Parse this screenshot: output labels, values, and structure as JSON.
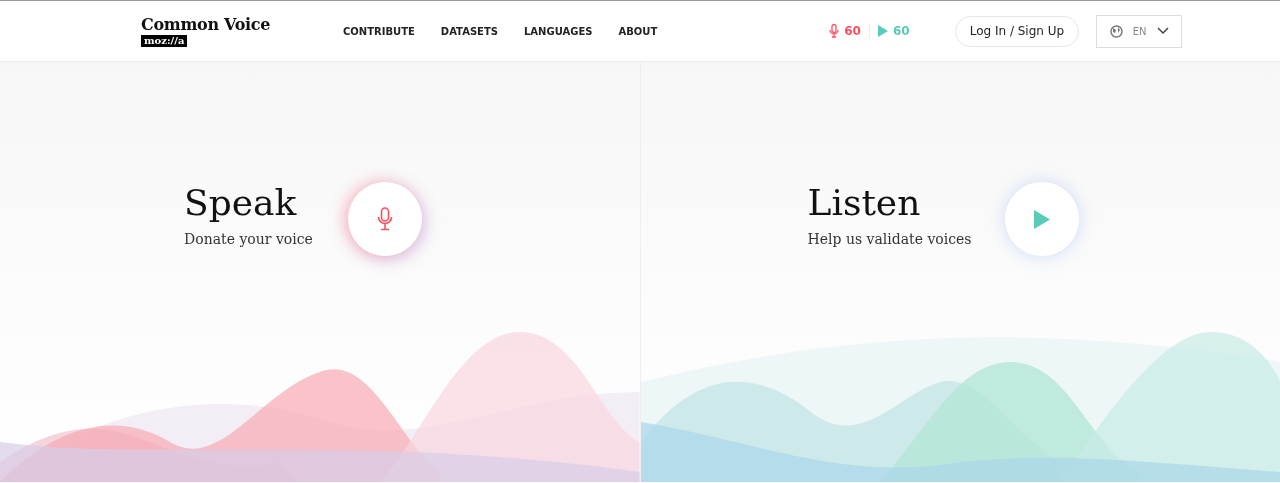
{
  "header": {
    "logo": "Common Voice",
    "logo_badge": "moz://a",
    "nav": [
      {
        "label": "CONTRIBUTE"
      },
      {
        "label": "DATASETS"
      },
      {
        "label": "LANGUAGES"
      },
      {
        "label": "ABOUT"
      }
    ],
    "stats": [
      {
        "kind": "speak",
        "count": "60"
      },
      {
        "kind": "listen",
        "count": "60"
      }
    ],
    "login": "Log In / Sign Up",
    "language": "EN"
  },
  "panels": [
    {
      "kind": "speak",
      "title": "Speak",
      "subtitle": "Donate your voice"
    },
    {
      "kind": "listen",
      "title": "Listen",
      "subtitle": "Help us validate voices"
    }
  ]
}
